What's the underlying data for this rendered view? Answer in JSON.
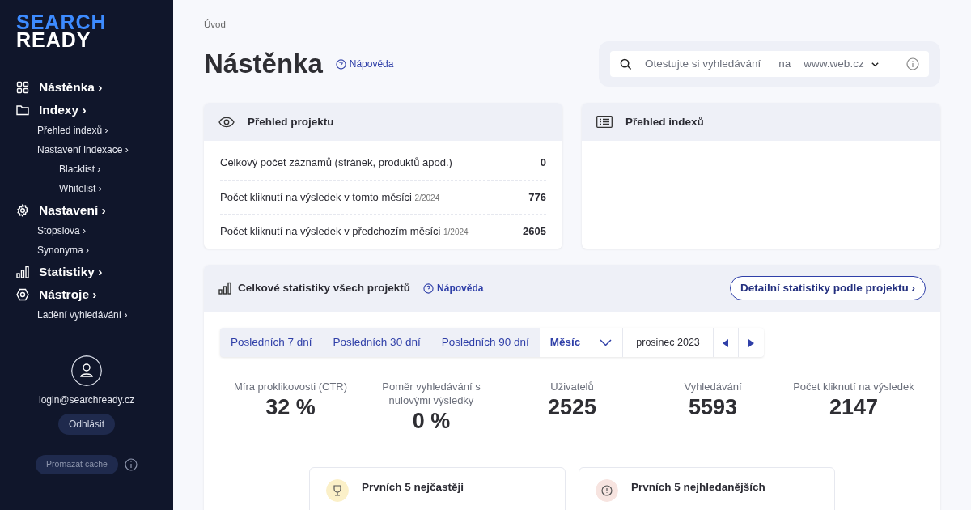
{
  "logo": {
    "line_1": "SEARCH",
    "line_2": "READY"
  },
  "sidebar": {
    "sections": [
      {
        "label": "Nástěnka",
        "chevron": "›"
      },
      {
        "label": "Indexy",
        "chevron": "›",
        "items": [
          {
            "label": "Přehled indexů",
            "chevron": "›"
          },
          {
            "label": "Nastavení indexace",
            "chevron": "›",
            "children": [
              {
                "label": "Blacklist",
                "chevron": "›"
              },
              {
                "label": "Whitelist",
                "chevron": "›"
              }
            ]
          }
        ]
      },
      {
        "label": "Nastavení",
        "chevron": "›",
        "items": [
          {
            "label": "Stopslova",
            "chevron": "›"
          },
          {
            "label": "Synonyma",
            "chevron": "›"
          }
        ]
      },
      {
        "label": "Statistiky",
        "chevron": "›"
      },
      {
        "label": "Nástroje",
        "chevron": "›",
        "items": [
          {
            "label": "Ladění vyhledávání",
            "chevron": "›"
          }
        ]
      }
    ],
    "user": {
      "email": "login@searchready.cz",
      "logout": "Odhlásit"
    },
    "cache_button": "Promazat cache"
  },
  "breadcrumb": "Úvod",
  "page_title": "Nástěnka",
  "help_link": "Nápověda",
  "search_box": {
    "placeholder": "Otestujte si vyhledávání",
    "on_label": "na",
    "site": "www.web.cz"
  },
  "project_overview": {
    "title": "Přehled projektu",
    "rows": [
      {
        "label": "Celkový počet záznamů (stránek, produktů apod.)",
        "value": "0"
      },
      {
        "label": "Počet kliknutí na výsledek v tomto měsíci",
        "period": "2/2024",
        "value": "776"
      },
      {
        "label": "Počet kliknutí na výsledek v předchozím měsíci",
        "period": "1/2024",
        "value": "2605"
      }
    ]
  },
  "index_overview": {
    "title": "Přehled indexů"
  },
  "stats": {
    "title": "Celkové statistiky všech projektů",
    "help_link": "Nápověda",
    "detail_button": "Detailní statistiky podle projektu",
    "detail_chevron": "›",
    "ranges": [
      {
        "label": "Posledních 7 dní",
        "selected": false
      },
      {
        "label": "Posledních 30 dní",
        "selected": false
      },
      {
        "label": "Posledních 90 dní",
        "selected": false
      },
      {
        "label": "Měsíc",
        "selected": true
      }
    ],
    "month": "prosinec 2023",
    "metrics": [
      {
        "label": "Míra proklikovosti (CTR)",
        "value": "32 %"
      },
      {
        "label": "Poměr vyhledávání s nulovými výsledky",
        "value": "0 %"
      },
      {
        "label": "Uživatelů",
        "value": "2525"
      },
      {
        "label": "Vyhledávání",
        "value": "5593"
      },
      {
        "label": "Počet kliknutí na výsledek",
        "value": "2147"
      }
    ],
    "top_cards": [
      {
        "kind": "trophy",
        "title": "Prvních 5 nejčastěji"
      },
      {
        "kind": "alert",
        "title": "Prvních 5 nejhledanějších"
      }
    ]
  }
}
